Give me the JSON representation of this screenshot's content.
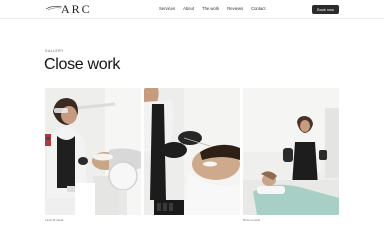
{
  "header": {
    "logo_text": "ARC",
    "nav": [
      "Services",
      "About",
      "The work",
      "Reviews",
      "Contact"
    ],
    "cta_label": "Book now"
  },
  "section": {
    "eyebrow": "GALLERY",
    "title": "Close work"
  },
  "gallery": {
    "captions": [
      "Lash lift detail",
      "Brow consult"
    ]
  }
}
